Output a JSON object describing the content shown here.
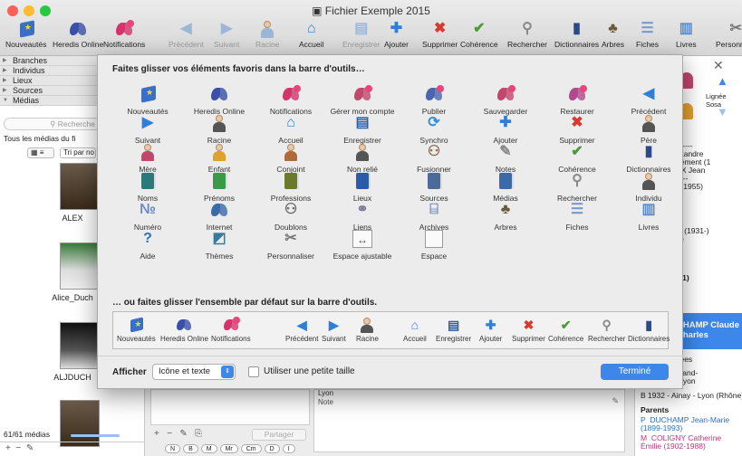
{
  "window": {
    "title": "Fichier Exemple 2015"
  },
  "toolbar": {
    "items": [
      {
        "label": "Nouveautés",
        "icon": "star-flag-icon"
      },
      {
        "label": "Heredis Online",
        "icon": "butterfly-icon"
      },
      {
        "label": "Notifications",
        "icon": "notification-butterfly-icon"
      },
      {
        "label": "Précédent",
        "icon": "arrow-left-icon",
        "disabled": true
      },
      {
        "label": "Suivant",
        "icon": "arrow-right-icon",
        "disabled": true
      },
      {
        "label": "Racine",
        "icon": "root-person-icon",
        "disabled": true
      },
      {
        "label": "Accueil",
        "icon": "home-icon"
      },
      {
        "label": "Enregistrer",
        "icon": "save-icon",
        "disabled": true
      },
      {
        "label": "Ajouter",
        "icon": "plus-icon"
      },
      {
        "label": "Supprimer",
        "icon": "delete-x-icon"
      },
      {
        "label": "Cohérence",
        "icon": "check-leaf-icon"
      },
      {
        "label": "Rechercher",
        "icon": "magnifier-icon"
      },
      {
        "label": "Dictionnaires",
        "icon": "book-icon"
      },
      {
        "label": "Arbres",
        "icon": "tree-icon"
      },
      {
        "label": "Fiches",
        "icon": "cards-icon"
      },
      {
        "label": "Livres",
        "icon": "open-book-icon"
      },
      {
        "label": "Personnalis",
        "icon": "tools-icon"
      }
    ]
  },
  "sidebar": {
    "sections": [
      "Branches",
      "Individus",
      "Lieux",
      "Sources",
      "Médias"
    ],
    "search_placeholder": "Recherche",
    "filter_label": "Tous les médias du fi",
    "sort_label": "Tri par no",
    "media": [
      {
        "caption": "ALEX"
      },
      {
        "caption": "Alice_Duch"
      },
      {
        "caption": "ALJDUCH"
      },
      {
        "caption": ""
      }
    ],
    "count": "61/61 médias"
  },
  "dialog": {
    "title": "Faites glisser vos éléments favoris dans la barre d'outils…",
    "grid": [
      {
        "label": "Nouveautés",
        "icon": "star-flag-icon",
        "color": "#3b6fc6"
      },
      {
        "label": "Heredis Online",
        "icon": "butterfly-icon",
        "color": "#3a4fa8"
      },
      {
        "label": "Notifications",
        "icon": "notification-butterfly-icon",
        "color": "#d6336c"
      },
      {
        "label": "Gérer mon compte",
        "icon": "account-butterfly-icon",
        "color": "#c0486c"
      },
      {
        "label": "Publier",
        "icon": "publish-butterfly-icon",
        "color": "#4a66b0"
      },
      {
        "label": "Sauvegarder",
        "icon": "backup-butterfly-icon",
        "color": "#c0486c"
      },
      {
        "label": "Restaurer",
        "icon": "restore-butterfly-icon",
        "color": "#b04a8c"
      },
      {
        "label": "Précédent",
        "icon": "arrow-left-icon",
        "color": "#2f7fd8"
      },
      {
        "label": "Suivant",
        "icon": "arrow-right-icon",
        "color": "#2f7fd8"
      },
      {
        "label": "Racine",
        "icon": "root-person-icon",
        "color": "#555"
      },
      {
        "label": "Accueil",
        "icon": "home-icon",
        "color": "#2f7fd8"
      },
      {
        "label": "Enregistrer",
        "icon": "save-icon",
        "color": "#2f5fa8"
      },
      {
        "label": "Synchro",
        "icon": "sync-icon",
        "color": "#2f8fd8"
      },
      {
        "label": "Ajouter",
        "icon": "plus-icon",
        "color": "#2f7fd8"
      },
      {
        "label": "Supprimer",
        "icon": "delete-x-icon",
        "color": "#d83a2f"
      },
      {
        "label": "Père",
        "icon": "father-icon",
        "color": "#555"
      },
      {
        "label": "Mère",
        "icon": "mother-icon",
        "color": "#c0486c"
      },
      {
        "label": "Enfant",
        "icon": "child-icon",
        "color": "#e0a030"
      },
      {
        "label": "Conjoint",
        "icon": "spouse-icon",
        "color": "#b06a3a"
      },
      {
        "label": "Non relié",
        "icon": "unlinked-icon",
        "color": "#555"
      },
      {
        "label": "Fusionner",
        "icon": "merge-icon",
        "color": "#8a6a4a"
      },
      {
        "label": "Notes",
        "icon": "notes-icon",
        "color": "#888"
      },
      {
        "label": "Cohérence",
        "icon": "check-leaf-icon",
        "color": "#4a9a3a"
      },
      {
        "label": "Dictionnaires",
        "icon": "book-icon",
        "color": "#2a4a8a"
      },
      {
        "label": "Noms",
        "icon": "names-book-icon",
        "color": "#2a7a7a"
      },
      {
        "label": "Prénoms",
        "icon": "firstnames-book-icon",
        "color": "#3a9a4a"
      },
      {
        "label": "Professions",
        "icon": "professions-book-icon",
        "color": "#6a7a2a"
      },
      {
        "label": "Lieux",
        "icon": "places-book-icon",
        "color": "#2a5aa8"
      },
      {
        "label": "Sources",
        "icon": "sources-book-icon",
        "color": "#4a6a9a"
      },
      {
        "label": "Médias",
        "icon": "media-book-icon",
        "color": "#3a6aaa"
      },
      {
        "label": "Rechercher",
        "icon": "magnifier-icon",
        "color": "#888"
      },
      {
        "label": "Individu",
        "icon": "individual-icon",
        "color": "#555"
      },
      {
        "label": "Numéro",
        "icon": "number-icon",
        "color": "#6a8aca"
      },
      {
        "label": "Internet",
        "icon": "internet-butterfly-icon",
        "color": "#3a6aa8"
      },
      {
        "label": "Doublons",
        "icon": "duplicates-icon",
        "color": "#666"
      },
      {
        "label": "Liens",
        "icon": "links-icon",
        "color": "#7a7a9a"
      },
      {
        "label": "Archives",
        "icon": "archives-icon",
        "color": "#6a8aca"
      },
      {
        "label": "Arbres",
        "icon": "tree-icon",
        "color": "#6a5a3a"
      },
      {
        "label": "Fiches",
        "icon": "cards-icon",
        "color": "#7a9aca"
      },
      {
        "label": "Livres",
        "icon": "open-book-icon",
        "color": "#5a8aca"
      },
      {
        "label": "Aide",
        "icon": "help-icon",
        "color": "#2f6fc8"
      },
      {
        "label": "Thèmes",
        "icon": "themes-icon",
        "color": "#3a7a9a"
      },
      {
        "label": "Personnaliser",
        "icon": "tools-icon",
        "color": "#777"
      },
      {
        "label": "Espace ajustable",
        "icon": "flexible-space-icon",
        "color": "#555"
      },
      {
        "label": "Espace",
        "icon": "space-icon",
        "color": "#555"
      }
    ],
    "default_title": "… ou faites glisser l'ensemble par défaut sur la barre d'outils.",
    "default_set": [
      {
        "label": "Nouveautés",
        "icon": "star-flag-icon"
      },
      {
        "label": "Heredis Online",
        "icon": "butterfly-icon"
      },
      {
        "label": "Notifications",
        "icon": "notification-butterfly-icon"
      },
      {
        "label": "Précédent",
        "icon": "arrow-left-icon"
      },
      {
        "label": "Suivant",
        "icon": "arrow-right-icon"
      },
      {
        "label": "Racine",
        "icon": "root-person-icon"
      },
      {
        "label": "Accueil",
        "icon": "home-icon"
      },
      {
        "label": "Enregistrer",
        "icon": "save-icon"
      },
      {
        "label": "Ajouter",
        "icon": "plus-icon"
      },
      {
        "label": "Supprimer",
        "icon": "delete-x-icon"
      },
      {
        "label": "Cohérence",
        "icon": "check-leaf-icon"
      },
      {
        "label": "Rechercher",
        "icon": "magnifier-icon"
      },
      {
        "label": "Dictionnaires",
        "icon": "book-icon"
      }
    ],
    "show_label": "Afficher",
    "show_value": "Icône et texte",
    "small_size_label": "Utiliser une petite taille",
    "small_size_checked": false,
    "done_label": "Terminé"
  },
  "right_panel": {
    "sosa_label": "Lignée Sosa",
    "lines": [
      "e Duchamp-----",
      "Charles Alexandre",
      "ET Louis Clément (1",
      "de la CHAUX Jean",
      "e Coligny------",
      "Louis (1863-1955)",
      "ude Charles (1931-)",
      "ARENTS (4)",
      "(2)",
      "RENTS",
      "T TANTES (1)"
    ],
    "header_name": "CHAMP Claude Charles",
    "details": [
      "s & Chaussées",
      "- Chez sa grand-",
      "Godefroy - Lyon"
    ],
    "birth_line": "B  1932 - Ainay - Lyon (Rhône)",
    "parents_label": "Parents",
    "parents": [
      {
        "role": "P",
        "name": "DUCHAMP Jean-Marie (1899-1993)"
      },
      {
        "role": "M",
        "name": "COLIGNY Catherine Émilie (1902-1988)"
      }
    ]
  },
  "center_bottom": {
    "note_label": "Note",
    "lyon_text": "Lyon",
    "share_label": "Partager",
    "filters": [
      "N",
      "B",
      "M",
      "Mr",
      "Cm",
      "D",
      "I"
    ]
  },
  "colors": {
    "accent": "#3d87ea",
    "selected_header": "#3d87ea"
  }
}
